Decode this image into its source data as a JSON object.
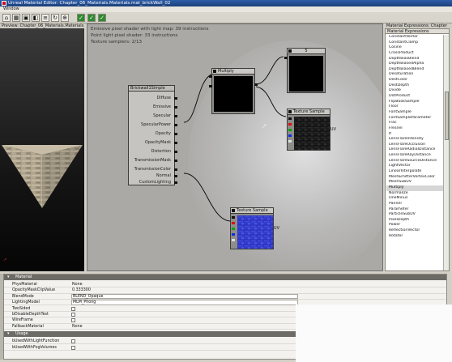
{
  "window": {
    "title": "Unreal Material Editor: Chapter_06_Materials.Materials.mat_brickWall_02",
    "menu": [
      "Window"
    ]
  },
  "toolbar": {
    "buttons": [
      "home-icon",
      "grid-icon",
      "node-icon",
      "preview-icon",
      "lines-icon",
      "refresh-icon",
      "zoom-icon",
      "check-icon",
      "check-icon",
      "check-icon"
    ]
  },
  "preview": {
    "panel_title": "Preview: Chapter_06_Materials.Materials.mat_..."
  },
  "canvas": {
    "stats": [
      "Emissive pixel shader with light map: 39 instructions",
      "Point light pixel shader: 33 instructions",
      "Texture samplers: 2/13"
    ],
    "nodes": {
      "multiply": "Multiply",
      "constant": "5",
      "texture1": "Texture Sample",
      "texture2": "Texture Sample",
      "material": "Brickwall1Simple"
    },
    "material_inputs": [
      "Diffuse",
      "Emissive",
      "Specular",
      "SpecularPower",
      "Opacity",
      "OpacityMask",
      "Distortion",
      "TransmissionMask",
      "TransmissionColor",
      "Normal",
      "CustomLighting"
    ],
    "texture_label": "UV"
  },
  "expressions": {
    "panel_title": "Material Expressions: Chapter",
    "header": "Material Expressions",
    "items": [
      "ConstantVector",
      "ConstantClamp",
      "Cosine",
      "CrossProduct",
      "DepthBiasBlend",
      "DepthBiasedAlpha",
      "DepthBiasedBlend",
      "Desaturation",
      "DestColor",
      "DestDepth",
      "Divide",
      "DotProduct",
      "FlipBookSample",
      "Floor",
      "FontSample",
      "FontSampleParameter",
      "Frac",
      "Fresnel",
      "If",
      "LensFlareIntensity",
      "LensFlareOcclusion",
      "LensFlareRadialDistance",
      "LensFlareRayDistance",
      "LensFlareSourceDistance",
      "LightVector",
      "LinearInterpolate",
      "MeshEmitterVertexColor",
      "MeshSubUV",
      "Multiply",
      "Normalize",
      "OneMinus",
      "Panner",
      "Parameter",
      "ParticleSubUV",
      "PixelDepth",
      "Power",
      "ReflectionVector",
      "Rotator"
    ],
    "selected": "Multiply"
  },
  "properties": {
    "section_material": "Material",
    "rows": [
      {
        "name": "PhysMaterial",
        "value": "None",
        "type": "text"
      },
      {
        "name": "OpacityMaskClipValue",
        "value": "0.333300",
        "type": "text"
      },
      {
        "name": "BlendMode",
        "value": "BLEND_Opaque",
        "type": "box"
      },
      {
        "name": "LightingModel",
        "value": "MLM_Phong",
        "type": "box"
      },
      {
        "name": "TwoSided",
        "value": "",
        "type": "check"
      },
      {
        "name": "bDisableDepthTest",
        "value": "",
        "type": "check"
      },
      {
        "name": "WireFrame",
        "value": "",
        "type": "check"
      },
      {
        "name": "FallbackMaterial",
        "value": "None",
        "type": "text"
      }
    ],
    "section_usage": "Usage",
    "usage_rows": [
      {
        "name": "bUsedWithLightFunction",
        "type": "check"
      },
      {
        "name": "bUsedWithFogVolumes",
        "type": "check"
      }
    ]
  }
}
